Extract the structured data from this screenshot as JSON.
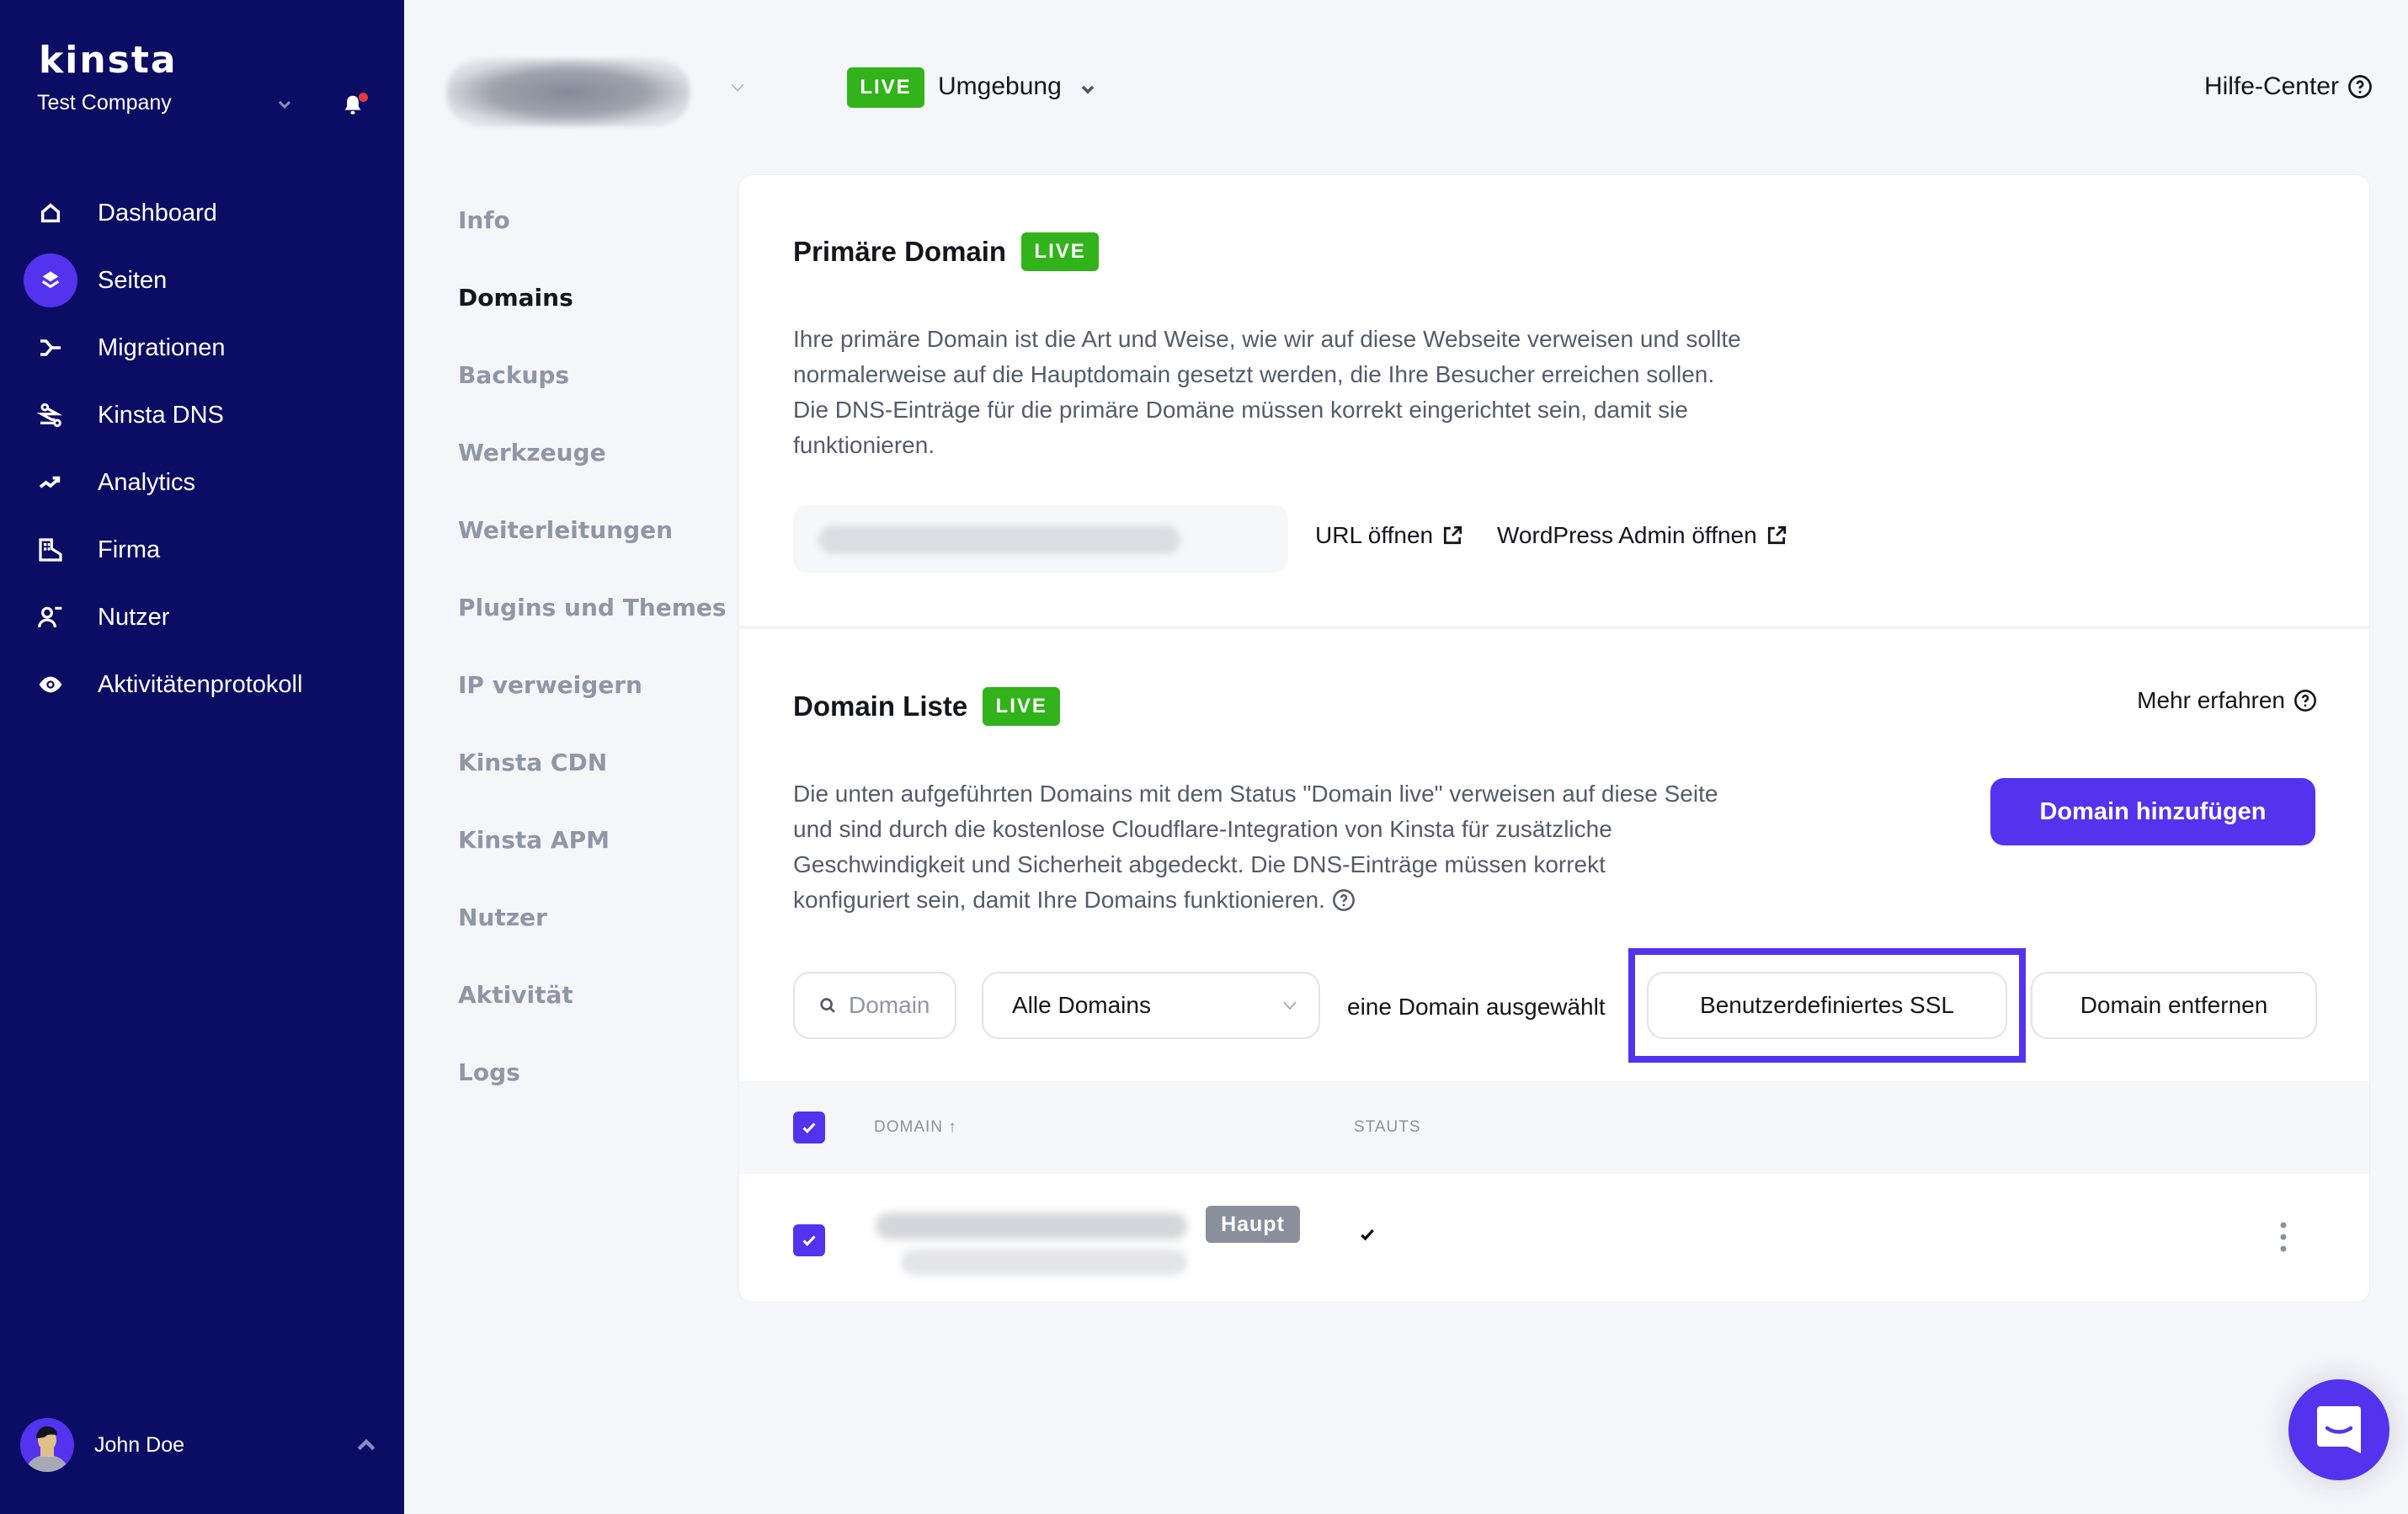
{
  "sidebar": {
    "brand": "kinsta",
    "company": "Test Company",
    "notifications_unread": true,
    "items": [
      {
        "label": "Dashboard",
        "icon": "home-icon",
        "active": false
      },
      {
        "label": "Seiten",
        "icon": "layers-icon",
        "active": true
      },
      {
        "label": "Migrationen",
        "icon": "migration-icon",
        "active": false
      },
      {
        "label": "Kinsta DNS",
        "icon": "dns-icon",
        "active": false
      },
      {
        "label": "Analytics",
        "icon": "trend-up-icon",
        "active": false
      },
      {
        "label": "Firma",
        "icon": "building-icon",
        "active": false
      },
      {
        "label": "Nutzer",
        "icon": "user-icon",
        "active": false
      },
      {
        "label": "Aktivitätenprotokoll",
        "icon": "eye-icon",
        "active": false
      }
    ],
    "user": {
      "name": "John Doe"
    }
  },
  "topbar": {
    "environment_badge": "LIVE",
    "environment_label": "Umgebung",
    "help_center": "Hilfe-Center"
  },
  "subnav": {
    "items": [
      {
        "label": "Info",
        "active": false
      },
      {
        "label": "Domains",
        "active": true
      },
      {
        "label": "Backups",
        "active": false
      },
      {
        "label": "Werkzeuge",
        "active": false
      },
      {
        "label": "Weiterleitungen",
        "active": false
      },
      {
        "label": "Plugins und Themes",
        "active": false
      },
      {
        "label": "IP verweigern",
        "active": false
      },
      {
        "label": "Kinsta CDN",
        "active": false
      },
      {
        "label": "Kinsta APM",
        "active": false
      },
      {
        "label": "Nutzer",
        "active": false
      },
      {
        "label": "Aktivität",
        "active": false
      },
      {
        "label": "Logs",
        "active": false
      }
    ]
  },
  "primary_domain": {
    "title": "Primäre Domain",
    "badge": "LIVE",
    "description": [
      "Ihre primäre Domain ist die Art und Weise, wie wir auf diese Webseite verweisen und sollte",
      "normalerweise auf die Hauptdomain gesetzt werden, die Ihre Besucher erreichen sollen.",
      "Die DNS-Einträge für die primäre Domäne müssen korrekt eingerichtet sein, damit sie",
      "funktionieren."
    ],
    "open_url": "URL öffnen",
    "open_wp_admin": "WordPress Admin öffnen"
  },
  "domain_list": {
    "title": "Domain Liste",
    "badge": "LIVE",
    "learn_more": "Mehr erfahren",
    "add_button": "Domain hinzufügen",
    "description": [
      "Die unten aufgeführten Domains mit dem Status \"Domain live\" verweisen auf diese Seite",
      "und sind durch die kostenlose Cloudflare-Integration von Kinsta für zusätzliche",
      "Geschwindigkeit und Sicherheit abgedeckt. Die DNS-Einträge müssen korrekt",
      "konfiguriert sein, damit Ihre Domains funktionieren."
    ],
    "search_placeholder": "Domain",
    "filter_selected": "Alle Domains",
    "selection_text": "eine Domain ausgewählt",
    "custom_ssl_button": "Benutzerdefiniertes SSL",
    "remove_button": "Domain entfernen",
    "columns": {
      "domain": "DOMAIN ↑",
      "status": "STAUTS"
    },
    "rows": [
      {
        "checked": true,
        "badge": "Haupt",
        "status": "✔"
      }
    ]
  },
  "colors": {
    "sidebar_bg": "#0b0c64",
    "accent": "#5333ed",
    "live_green": "#32b31b",
    "badge_gray": "#8b8f9b"
  }
}
